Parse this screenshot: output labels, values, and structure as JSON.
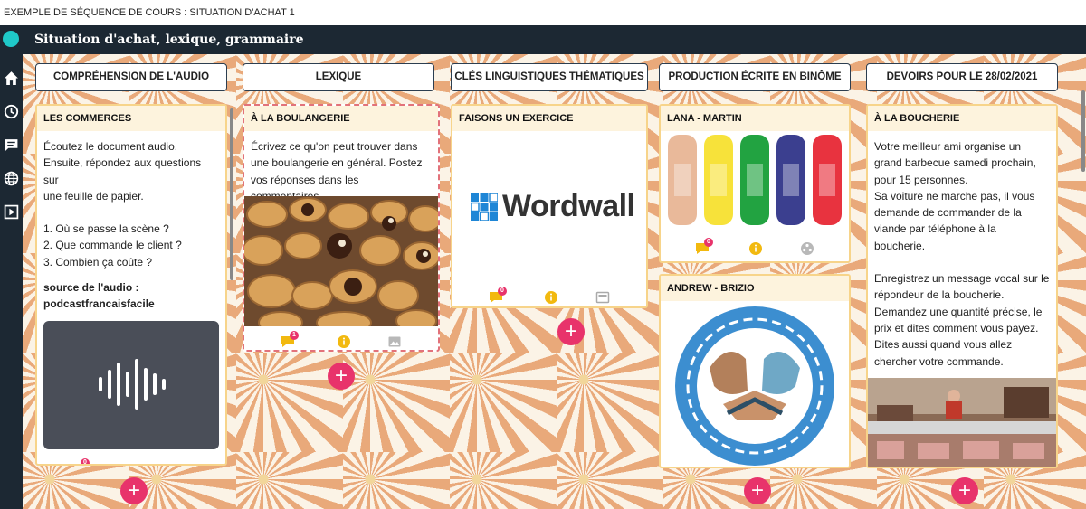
{
  "window": {
    "title": "EXEMPLE DE SÉQUENCE DE COURS : SITUATION D'ACHAT 1"
  },
  "header": {
    "title": "Situation d'achat, lexique, grammaire"
  },
  "sidebar": {
    "icons": [
      "home-icon",
      "clock-icon",
      "chat-icon",
      "globe-icon",
      "play-icon"
    ]
  },
  "columns": [
    {
      "title": "COMPRÉHENSION DE L'AUDIO"
    },
    {
      "title": "LEXIQUE"
    },
    {
      "title": "CLÉS LINGUISTIQUES THÉMATIQUES"
    },
    {
      "title": "PRODUCTION ÉCRITE EN BINÔME"
    },
    {
      "title": "DEVOIRS POUR LE 28/02/2021"
    }
  ],
  "cards": {
    "commerces": {
      "title": "LES COMMERCES",
      "p1": "Écoutez le document audio.",
      "p2": "Ensuite, répondez aux questions sur",
      "p3": "une feuille de papier.",
      "q1": "1. Où se passe la scène ?",
      "q2": "2. Que commande le client ?",
      "q3": "3. Combien ça coûte ?",
      "source1": "source de l'audio :",
      "source2": "podcastfrancaisfacile",
      "comments": "0"
    },
    "boulangerie": {
      "title": "À LA BOULANGERIE",
      "l1": "Écrivez ce qu'on peut trouver dans",
      "l2": "une boulangerie en général. Postez",
      "l3": "vos réponses dans les commentaires.",
      "comments": "1"
    },
    "exercice": {
      "title": "FAISONS UN EXERCICE",
      "logo_text": "Wordwall",
      "comments": "0"
    },
    "lana": {
      "title": "LANA - MARTIN",
      "comments": "0",
      "bandage_colors": [
        "#e9b99a",
        "#f7e23a",
        "#22a341",
        "#3b3f8f",
        "#e8333f"
      ]
    },
    "andrew": {
      "title": "ANDREW - BRIZIO"
    },
    "boucherie": {
      "title": "À LA BOUCHERIE",
      "l1": "Votre meilleur ami organise un",
      "l2": "grand barbecue samedi prochain,",
      "l3": "pour 15 personnes.",
      "l4": "Sa voiture ne marche pas, il vous",
      "l5": "demande de commander de la",
      "l6": "viande par téléphone à la",
      "l7": "boucherie.",
      "l8": "Enregistrez un message vocal sur le",
      "l9": "répondeur de la boucherie.",
      "l10": "Demandez une quantité précise, le",
      "l11": "prix et dites comment vous payez.",
      "l12": "Dites aussi quand vous allez",
      "l13": "chercher votre commande."
    }
  },
  "colors": {
    "accent": "#e8336b",
    "header_bg": "#1c2833",
    "logo": "#1fc9c9",
    "card_border": "#f7d48a"
  }
}
